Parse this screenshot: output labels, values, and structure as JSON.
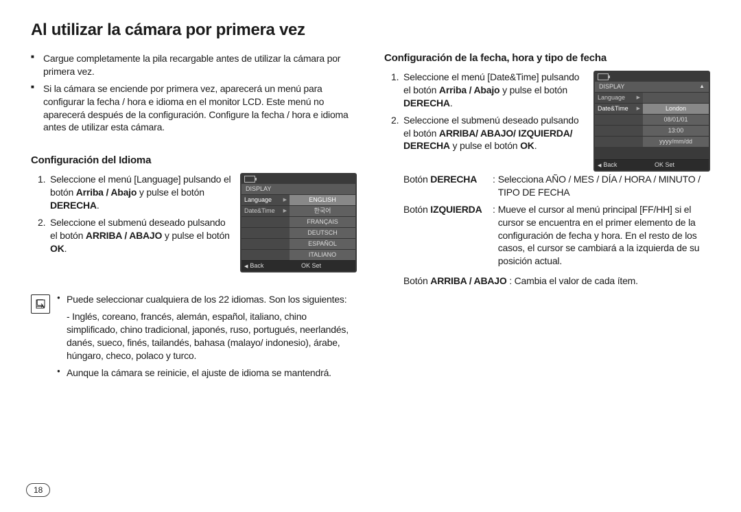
{
  "title": "Al utilizar la cámara por primera vez",
  "intro": {
    "b1": "Cargue completamente la pila recargable antes de utilizar la cámara por primera vez.",
    "b2": "Si la cámara se enciende por primera vez, aparecerá un menú para configurar la fecha / hora e idioma en el monitor LCD. Este menú no aparecerá después de la configuración. Configure la fecha / hora e idioma antes de utilizar esta cámara."
  },
  "lang_section": {
    "heading": "Configuración del Idioma",
    "s1_pre": "Seleccione el menú [Language] pulsando el botón ",
    "s1_bold": "Arriba / Abajo",
    "s1_mid": " y pulse el botón ",
    "s1_bold2": "DERECHA",
    "s1_post": ".",
    "s2_pre": "Seleccione el submenú deseado pulsando el botón ",
    "s2_bold": "ARRIBA / ABAJO",
    "s2_mid": " y pulse el botón ",
    "s2_bold2": "OK",
    "s2_post": "."
  },
  "lang_lcd": {
    "header": "DISPLAY",
    "row1": "Language",
    "row1v": "ENGLISH",
    "row2": "Date&Time",
    "opt2": "한국어",
    "opt3": "FRANÇAIS",
    "opt4": "DEUTSCH",
    "opt5": "ESPAÑOL",
    "opt6": "ITALIANO",
    "back": "Back",
    "ok": "OK",
    "set": "Set"
  },
  "note": {
    "b1": "Puede seleccionar cualquiera de los 22 idiomas. Son los siguientes:",
    "b1_cont": "- Inglés, coreano, francés, alemán, español, italiano, chino simplificado, chino tradicional, japonés, ruso, portugués, neerlandés, danés, sueco, finés, tailandés, bahasa (malayo/ indonesio), árabe, húngaro, checo, polaco y turco.",
    "b2": "Aunque la cámara se reinicie, el ajuste de idioma se mantendrá."
  },
  "date_section": {
    "heading": "Configuración de la fecha, hora y tipo de fecha",
    "s1_pre": "Seleccione el menú [Date&Time] pulsando el botón ",
    "s1_bold": "Arriba / Abajo",
    "s1_mid": " y pulse el botón ",
    "s1_bold2": "DERECHA",
    "s1_post": ".",
    "s2_pre": "Seleccione el submenú deseado pulsando el botón ",
    "s2_bold": "ARRIBA/ ABAJO/ IZQUIERDA/ DERECHA",
    "s2_mid": " y pulse el botón ",
    "s2_bold2": "OK",
    "s2_post": ".",
    "btn_r_lbl": "Botón ",
    "btn_r_b": "DERECHA",
    "btn_r_val": "Selecciona AÑO / MES / DÍA / HORA / MINUTO / TIPO DE FECHA",
    "btn_l_lbl": "Botón ",
    "btn_l_b": "IZQUIERDA",
    "btn_l_val": "Mueve el cursor al menú principal [FF/HH] si el cursor se encuentra en el primer elemento de la configuración de fecha y hora. En el resto de los casos, el cursor se cambiará a la izquierda de su posición actual.",
    "btn_ud_pre": "Botón ",
    "btn_ud_b": "ARRIBA / ABAJO",
    "btn_ud_post": " : Cambia el valor de cada ítem."
  },
  "date_lcd": {
    "header": "DISPLAY",
    "row1": "Language",
    "row2": "Date&Time",
    "val1": "London",
    "val2": "08/01/01",
    "val3": "13:00",
    "val4": "yyyy/mm/dd",
    "back": "Back",
    "ok": "OK",
    "set": "Set"
  },
  "page_no": "18"
}
